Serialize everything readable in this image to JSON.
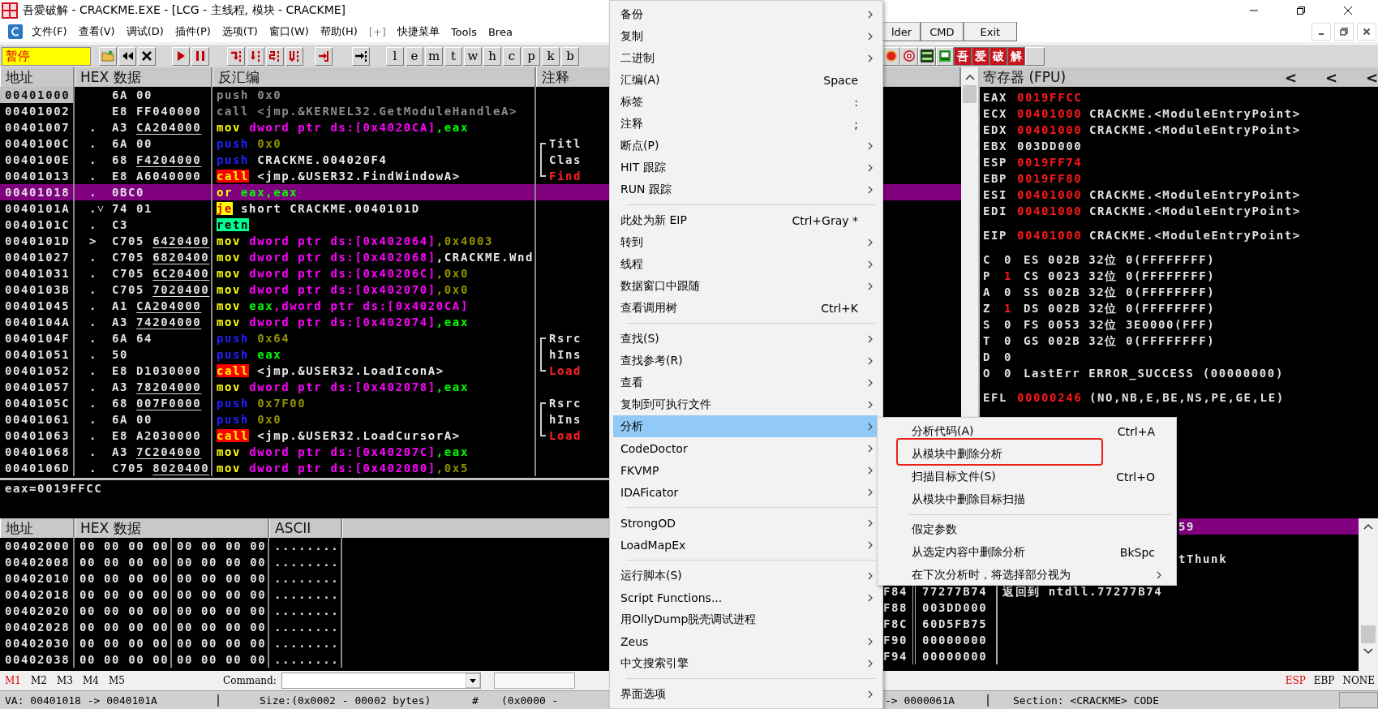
{
  "window": {
    "title": "吾愛破解 - CRACKME.EXE - [LCG -  主线程, 模块 - CRACKME]"
  },
  "menubar": {
    "items": [
      {
        "label": "文件(F)",
        "disabled": false
      },
      {
        "label": "查看(V)",
        "disabled": false
      },
      {
        "label": "调试(D)",
        "disabled": false
      },
      {
        "label": "插件(P)",
        "disabled": false
      },
      {
        "label": "选项(T)",
        "disabled": false
      },
      {
        "label": "窗口(W)",
        "disabled": false
      },
      {
        "label": "帮助(H)",
        "disabled": false
      },
      {
        "label": "[+]",
        "disabled": true
      },
      {
        "label": "快捷菜单",
        "disabled": false
      },
      {
        "label": "Tools",
        "disabled": false
      },
      {
        "label": "Brea",
        "disabled": false
      }
    ],
    "buttons": [
      "lder",
      "CMD",
      "Exit"
    ]
  },
  "toolbar": {
    "status": "暂停",
    "letters": [
      "l",
      "e",
      "m",
      "t",
      "w",
      "h",
      "c",
      "p",
      "k",
      "b"
    ],
    "tiles": [
      "吾",
      "爱",
      "破",
      "解"
    ]
  },
  "disassembly": {
    "columns": [
      "地址",
      "HEX 数据",
      "反汇编",
      "注释"
    ],
    "rows": [
      {
        "address": "00401000",
        "marker": "",
        "hex": "6A 00",
        "mnemonic": {
          "text": "push",
          "kind": "dim"
        },
        "operands": [
          {
            "text": "0x0",
            "kind": "dim"
          }
        ],
        "eip": true,
        "selected": false
      },
      {
        "address": "00401002",
        "marker": "",
        "hex": "E8 FF040000",
        "mnemonic": {
          "text": "call",
          "kind": "dim"
        },
        "operands": [
          {
            "text": "<jmp.&KERNEL32.GetModuleHandleA>",
            "kind": "dim"
          }
        ],
        "eip": false,
        "selected": false
      },
      {
        "address": "00401007",
        "marker": ".",
        "hex": "A3",
        "fixup": "CA204000",
        "mnemonic": {
          "text": "mov",
          "kind": "mov"
        },
        "operands": [
          {
            "text": "dword ptr ds:[0x4020CA]",
            "kind": "mem"
          },
          {
            "text": ",eax",
            "kind": "reg"
          }
        ],
        "eip": false,
        "selected": false
      },
      {
        "address": "0040100C",
        "marker": ".",
        "hex": "6A 00",
        "mnemonic": {
          "text": "push",
          "kind": "push"
        },
        "operands": [
          {
            "text": "0x0",
            "kind": "imm"
          }
        ],
        "comment": {
          "text": "Titl",
          "kind": "top",
          "is_call": false
        },
        "eip": false,
        "selected": false
      },
      {
        "address": "0040100E",
        "marker": ".",
        "hex": "68",
        "fixup": "F4204000",
        "mnemonic": {
          "text": "push",
          "kind": "push"
        },
        "operands": [
          {
            "text": "CRACKME.004020F4",
            "kind": "sym"
          }
        ],
        "comment": {
          "text": "Clas",
          "kind": "middle",
          "is_call": false
        },
        "eip": false,
        "selected": false
      },
      {
        "address": "00401013",
        "marker": ".",
        "hex": "E8 A6040000",
        "mnemonic": {
          "text": "call",
          "kind": "call"
        },
        "operands": [
          {
            "text": "<jmp.&USER32.FindWindowA>",
            "kind": "sym"
          }
        ],
        "comment": {
          "text": "Find",
          "kind": "bottom",
          "is_call": true
        },
        "eip": false,
        "selected": false
      },
      {
        "address": "00401018",
        "marker": ".",
        "hex": "0BC0",
        "mnemonic": {
          "text": "or",
          "kind": "mov"
        },
        "operands": [
          {
            "text": "eax,eax",
            "kind": "reg"
          }
        ],
        "eip": false,
        "selected": true
      },
      {
        "address": "0040101A",
        "marker": ".˅",
        "hex": "74 01",
        "mnemonic": {
          "text": "je",
          "kind": "jcc"
        },
        "operands": [
          {
            "text": "short CRACKME.0040101D",
            "kind": "sym"
          }
        ],
        "eip": false,
        "selected": false
      },
      {
        "address": "0040101C",
        "marker": ".",
        "hex": "C3",
        "mnemonic": {
          "text": "retn",
          "kind": "ret"
        },
        "operands": [],
        "eip": false,
        "selected": false
      },
      {
        "address": "0040101D",
        "marker": ">",
        "hex": "C705",
        "fixup": "6420400",
        "mnemonic": {
          "text": "mov",
          "kind": "mov"
        },
        "operands": [
          {
            "text": "dword ptr ds:[0x402064]",
            "kind": "mem"
          },
          {
            "text": ",0x4003",
            "kind": "imm"
          }
        ],
        "eip": false,
        "selected": false
      },
      {
        "address": "00401027",
        "marker": ".",
        "hex": "C705",
        "fixup": "6820400",
        "mnemonic": {
          "text": "mov",
          "kind": "mov"
        },
        "operands": [
          {
            "text": "dword ptr ds:[0x402068]",
            "kind": "mem"
          },
          {
            "text": ",CRACKME.Wnd",
            "kind": "sym"
          }
        ],
        "eip": false,
        "selected": false
      },
      {
        "address": "00401031",
        "marker": ".",
        "hex": "C705",
        "fixup": "6C20400",
        "mnemonic": {
          "text": "mov",
          "kind": "mov"
        },
        "operands": [
          {
            "text": "dword ptr ds:[0x40206C]",
            "kind": "mem"
          },
          {
            "text": ",0x0",
            "kind": "imm"
          }
        ],
        "eip": false,
        "selected": false
      },
      {
        "address": "0040103B",
        "marker": ".",
        "hex": "C705",
        "fixup": "7020400",
        "mnemonic": {
          "text": "mov",
          "kind": "mov"
        },
        "operands": [
          {
            "text": "dword ptr ds:[0x402070]",
            "kind": "mem"
          },
          {
            "text": ",0x0",
            "kind": "imm"
          }
        ],
        "eip": false,
        "selected": false
      },
      {
        "address": "00401045",
        "marker": ".",
        "hex": "A1",
        "fixup": "CA204000",
        "mnemonic": {
          "text": "mov",
          "kind": "mov"
        },
        "operands": [
          {
            "text": "eax",
            "kind": "reg"
          },
          {
            "text": ",dword ptr ds:[0x4020CA]",
            "kind": "mem"
          }
        ],
        "eip": false,
        "selected": false
      },
      {
        "address": "0040104A",
        "marker": ".",
        "hex": "A3",
        "fixup": "74204000",
        "mnemonic": {
          "text": "mov",
          "kind": "mov"
        },
        "operands": [
          {
            "text": "dword ptr ds:[0x402074]",
            "kind": "mem"
          },
          {
            "text": ",eax",
            "kind": "reg"
          }
        ],
        "eip": false,
        "selected": false
      },
      {
        "address": "0040104F",
        "marker": ".",
        "hex": "6A 64",
        "mnemonic": {
          "text": "push",
          "kind": "push"
        },
        "operands": [
          {
            "text": "0x64",
            "kind": "imm"
          }
        ],
        "comment": {
          "text": "Rsrc",
          "kind": "top",
          "is_call": false
        },
        "eip": false,
        "selected": false
      },
      {
        "address": "00401051",
        "marker": ".",
        "hex": "50",
        "mnemonic": {
          "text": "push",
          "kind": "push"
        },
        "operands": [
          {
            "text": "eax",
            "kind": "reg"
          }
        ],
        "comment": {
          "text": "hIns",
          "kind": "middle",
          "is_call": false
        },
        "eip": false,
        "selected": false
      },
      {
        "address": "00401052",
        "marker": ".",
        "hex": "E8 D1030000",
        "mnemonic": {
          "text": "call",
          "kind": "call"
        },
        "operands": [
          {
            "text": "<jmp.&USER32.LoadIconA>",
            "kind": "sym"
          }
        ],
        "comment": {
          "text": "Load",
          "kind": "bottom",
          "is_call": true
        },
        "eip": false,
        "selected": false
      },
      {
        "address": "00401057",
        "marker": ".",
        "hex": "A3",
        "fixup": "78204000",
        "mnemonic": {
          "text": "mov",
          "kind": "mov"
        },
        "operands": [
          {
            "text": "dword ptr ds:[0x402078]",
            "kind": "mem"
          },
          {
            "text": ",eax",
            "kind": "reg"
          }
        ],
        "eip": false,
        "selected": false
      },
      {
        "address": "0040105C",
        "marker": ".",
        "hex": "68",
        "fixup": "007F0000",
        "mnemonic": {
          "text": "push",
          "kind": "push"
        },
        "operands": [
          {
            "text": "0x7F00",
            "kind": "imm"
          }
        ],
        "comment": {
          "text": "Rsrc",
          "kind": "top",
          "is_call": false
        },
        "eip": false,
        "selected": false
      },
      {
        "address": "00401061",
        "marker": ".",
        "hex": "6A 00",
        "mnemonic": {
          "text": "push",
          "kind": "push"
        },
        "operands": [
          {
            "text": "0x0",
            "kind": "imm"
          }
        ],
        "comment": {
          "text": "hIns",
          "kind": "middle",
          "is_call": false
        },
        "eip": false,
        "selected": false
      },
      {
        "address": "00401063",
        "marker": ".",
        "hex": "E8 A2030000",
        "mnemonic": {
          "text": "call",
          "kind": "call"
        },
        "operands": [
          {
            "text": "<jmp.&USER32.LoadCursorA>",
            "kind": "sym"
          }
        ],
        "comment": {
          "text": "Load",
          "kind": "bottom",
          "is_call": true
        },
        "eip": false,
        "selected": false
      },
      {
        "address": "00401068",
        "marker": ".",
        "hex": "A3",
        "fixup": "7C204000",
        "mnemonic": {
          "text": "mov",
          "kind": "mov"
        },
        "operands": [
          {
            "text": "dword ptr ds:[0x40207C]",
            "kind": "mem"
          },
          {
            "text": ",eax",
            "kind": "reg"
          }
        ],
        "eip": false,
        "selected": false
      },
      {
        "address": "0040106D",
        "marker": ".",
        "hex": "C705",
        "fixup": "8020400",
        "mnemonic": {
          "text": "mov",
          "kind": "mov"
        },
        "operands": [
          {
            "text": "dword ptr ds:[0x402080]",
            "kind": "mem"
          },
          {
            "text": ",0x5",
            "kind": "imm"
          }
        ],
        "eip": false,
        "selected": false
      }
    ]
  },
  "info": "eax=0019FFCC",
  "registers": {
    "title": "寄存器 (FPU)",
    "arrows": [
      "<",
      "<",
      "<"
    ],
    "groups": [
      [
        {
          "kind": "reg",
          "name": "EAX",
          "value": "0019FFCC",
          "changed": true
        },
        {
          "kind": "reg",
          "name": "ECX",
          "value": "00401000",
          "changed": true,
          "comment": "CRACKME.<ModuleEntryPoint>"
        },
        {
          "kind": "reg",
          "name": "EDX",
          "value": "00401000",
          "changed": true,
          "comment": "CRACKME.<ModuleEntryPoint>"
        },
        {
          "kind": "reg",
          "name": "EBX",
          "value": "003DD000",
          "changed": false
        },
        {
          "kind": "reg",
          "name": "ESP",
          "value": "0019FF74",
          "changed": true
        },
        {
          "kind": "reg",
          "name": "EBP",
          "value": "0019FF80",
          "changed": true
        },
        {
          "kind": "reg",
          "name": "ESI",
          "value": "00401000",
          "changed": true,
          "comment": "CRACKME.<ModuleEntryPoint>"
        },
        {
          "kind": "reg",
          "name": "EDI",
          "value": "00401000",
          "changed": true,
          "comment": "CRACKME.<ModuleEntryPoint>"
        }
      ],
      [
        {
          "kind": "reg",
          "name": "EIP",
          "value": "00401000",
          "changed": true,
          "comment": "CRACKME.<ModuleEntryPoint>"
        }
      ],
      [
        {
          "kind": "flag",
          "name": "C",
          "value": "0",
          "changed": false,
          "detail": "ES 002B 32位 0(FFFFFFFF)"
        },
        {
          "kind": "flag",
          "name": "P",
          "value": "1",
          "changed": true,
          "detail": "CS 0023 32位 0(FFFFFFFF)"
        },
        {
          "kind": "flag",
          "name": "A",
          "value": "0",
          "changed": false,
          "detail": "SS 002B 32位 0(FFFFFFFF)"
        },
        {
          "kind": "flag",
          "name": "Z",
          "value": "1",
          "changed": true,
          "detail": "DS 002B 32位 0(FFFFFFFF)"
        },
        {
          "kind": "flag",
          "name": "S",
          "value": "0",
          "changed": false,
          "detail": "FS 0053 32位 3E0000(FFF)"
        },
        {
          "kind": "flag",
          "name": "T",
          "value": "0",
          "changed": false,
          "detail": "GS 002B 32位 0(FFFFFFFF)"
        },
        {
          "kind": "flag",
          "name": "D",
          "value": "0",
          "changed": false
        },
        {
          "kind": "flag",
          "name": "O",
          "value": "0",
          "changed": false,
          "detail": "LastErr ERROR_SUCCESS (00000000)"
        }
      ],
      [
        {
          "kind": "reg",
          "name": "EFL",
          "value": "00000246",
          "changed": true,
          "comment": "(NO,NB,E,BE,NS,PE,GE,LE)"
        }
      ]
    ]
  },
  "dump": {
    "columns": [
      "地址",
      "HEX 数据",
      "ASCII"
    ],
    "rows": [
      {
        "address": "00402000",
        "hex_1": "00 00 00 00",
        "hex_2": "00 00 00 00",
        "ascii": "........"
      },
      {
        "address": "00402008",
        "hex_1": "00 00 00 00",
        "hex_2": "00 00 00 00",
        "ascii": "........"
      },
      {
        "address": "00402010",
        "hex_1": "00 00 00 00",
        "hex_2": "00 00 00 00",
        "ascii": "........"
      },
      {
        "address": "00402018",
        "hex_1": "00 00 00 00",
        "hex_2": "00 00 00 00",
        "ascii": "........"
      },
      {
        "address": "00402020",
        "hex_1": "00 00 00 00",
        "hex_2": "00 00 00 00",
        "ascii": "........"
      },
      {
        "address": "00402028",
        "hex_1": "00 00 00 00",
        "hex_2": "00 00 00 00",
        "ascii": "........"
      },
      {
        "address": "00402030",
        "hex_1": "00 00 00 00",
        "hex_2": "00 00 00 00",
        "ascii": "........"
      },
      {
        "address": "00402038",
        "hex_1": "00 00 00 00",
        "hex_2": "00 00 00 00",
        "ascii": "........"
      }
    ]
  },
  "stack": {
    "rows": [
      {
        "kind": "covered",
        "comment": "59",
        "selected": true
      },
      {
        "kind": "covered",
        "selected": false
      },
      {
        "kind": "covered",
        "comment": "tThunk",
        "selected": false
      },
      {
        "kind": "covered",
        "selected": false
      },
      {
        "kind": "full",
        "address": "F84",
        "value": "77277B74",
        "comment": "返回到 ntdll.77277B74",
        "selected": false
      },
      {
        "kind": "full",
        "address": "F88",
        "value": "003DD000",
        "selected": false
      },
      {
        "kind": "full",
        "address": "F8C",
        "value": "60D5FB75",
        "selected": false
      },
      {
        "kind": "full",
        "address": "F90",
        "value": "00000000",
        "selected": false
      },
      {
        "kind": "full",
        "address": "F94",
        "value": "00000000",
        "selected": false
      }
    ]
  },
  "context_menu": {
    "groups": [
      {
        "items": [
          {
            "label": "备份",
            "submenu": true,
            "selected": false
          },
          {
            "label": "复制",
            "submenu": true,
            "selected": false
          },
          {
            "label": "二进制",
            "submenu": true,
            "selected": false
          },
          {
            "label": "汇编(A)",
            "shortcut": "Space",
            "submenu": false,
            "selected": false
          },
          {
            "label": "标签",
            "shortcut": ":",
            "submenu": false,
            "selected": false
          },
          {
            "label": "注释",
            "shortcut": ";",
            "submenu": false,
            "selected": false
          },
          {
            "label": "断点(P)",
            "submenu": true,
            "selected": false
          },
          {
            "label": "HIT 跟踪",
            "submenu": true,
            "selected": false
          },
          {
            "label": "RUN 跟踪",
            "submenu": true,
            "selected": false
          }
        ]
      },
      {
        "items": [
          {
            "label": "此处为新 EIP",
            "shortcut": "Ctrl+Gray *",
            "submenu": false,
            "selected": false
          },
          {
            "label": "转到",
            "submenu": true,
            "selected": false
          },
          {
            "label": "线程",
            "submenu": true,
            "selected": false
          },
          {
            "label": "数据窗口中跟随",
            "submenu": true,
            "selected": false
          },
          {
            "label": "查看调用树",
            "shortcut": "Ctrl+K",
            "submenu": false,
            "selected": false
          }
        ]
      },
      {
        "items": [
          {
            "label": "查找(S)",
            "submenu": true,
            "selected": false
          },
          {
            "label": "查找参考(R)",
            "submenu": true,
            "selected": false
          },
          {
            "label": "查看",
            "submenu": true,
            "selected": false
          },
          {
            "label": "复制到可执行文件",
            "submenu": true,
            "selected": false
          },
          {
            "label": "分析",
            "submenu": true,
            "selected": true
          },
          {
            "label": "CodeDoctor",
            "submenu": true,
            "selected": false
          },
          {
            "label": "FKVMP",
            "submenu": true,
            "selected": false
          },
          {
            "label": "IDAFicator",
            "submenu": true,
            "selected": false
          }
        ]
      },
      {
        "items": [
          {
            "label": "StrongOD",
            "submenu": true,
            "selected": false
          },
          {
            "label": "LoadMapEx",
            "submenu": true,
            "selected": false
          }
        ]
      },
      {
        "items": [
          {
            "label": "运行脚本(S)",
            "submenu": true,
            "selected": false
          },
          {
            "label": "Script Functions...",
            "submenu": true,
            "selected": false
          },
          {
            "label": "用OllyDump脱壳调试进程",
            "submenu": false,
            "selected": false
          },
          {
            "label": "Zeus",
            "submenu": true,
            "selected": false
          },
          {
            "label": "中文搜索引擎",
            "submenu": true,
            "selected": false
          }
        ]
      },
      {
        "items": [
          {
            "label": "界面选项",
            "submenu": true,
            "selected": false
          }
        ]
      }
    ]
  },
  "submenu": {
    "groups": [
      {
        "items": [
          {
            "label": "分析代码(A)",
            "shortcut": "Ctrl+A",
            "submenu": false,
            "annotated": false
          },
          {
            "label": "从模块中删除分析",
            "submenu": false,
            "annotated": true
          },
          {
            "label": "扫描目标文件(S)",
            "shortcut": "Ctrl+O",
            "submenu": false,
            "annotated": false
          },
          {
            "label": "从模块中删除目标扫描",
            "submenu": false,
            "annotated": false
          }
        ]
      },
      {
        "items": [
          {
            "label": "假定参数",
            "submenu": false,
            "annotated": false
          },
          {
            "label": "从选定内容中删除分析",
            "shortcut": "BkSpc",
            "submenu": false,
            "annotated": false
          },
          {
            "label": "在下次分析时，将选择部分视为",
            "submenu": true,
            "annotated": false
          }
        ]
      }
    ]
  },
  "command_bar": {
    "markers": [
      {
        "label": "M1",
        "selected": true
      },
      {
        "label": "M2",
        "selected": false
      },
      {
        "label": "M3",
        "selected": false
      },
      {
        "label": "M4",
        "selected": false
      },
      {
        "label": "M5",
        "selected": false
      }
    ],
    "command_label": "Command:",
    "modes": [
      {
        "label": "ESP",
        "selected": true
      },
      {
        "label": "EBP",
        "selected": false
      },
      {
        "label": "NONE",
        "selected": false
      }
    ]
  },
  "status_bar": {
    "left": [
      "VA: 00401018 -> 0040101A",
      "Size:(0x0002 - 00002 bytes)",
      "#",
      "(0x0000 -"
    ],
    "right": [
      "-> 0000061A",
      "Section: <CRACKME> CODE"
    ]
  }
}
